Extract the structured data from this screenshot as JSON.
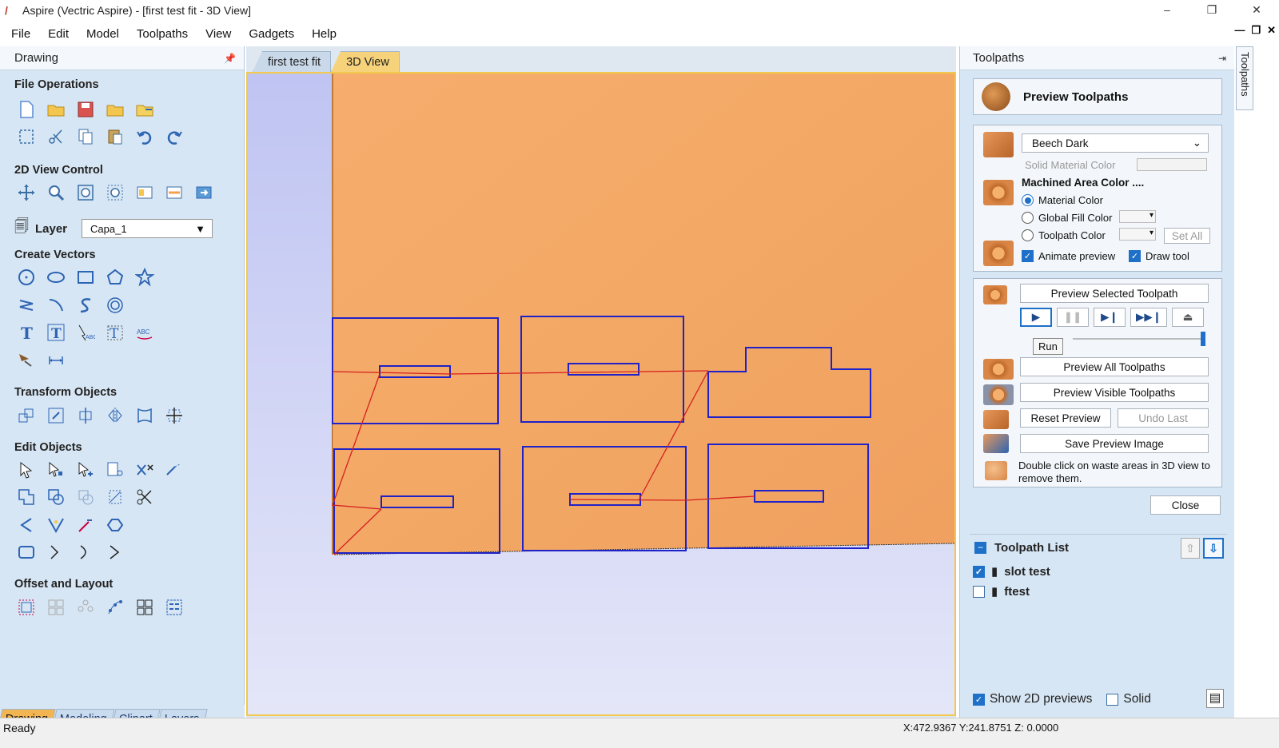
{
  "window": {
    "title": "Aspire (Vectric Aspire) - [first test fit - 3D View]",
    "minimize": "–",
    "restore": "❐",
    "close": "✕"
  },
  "menu": [
    "File",
    "Edit",
    "Model",
    "Toolpaths",
    "View",
    "Gadgets",
    "Help"
  ],
  "left_panel": {
    "title": "Drawing",
    "sections": {
      "file_operations": "File Operations",
      "view_control": "2D View Control",
      "create_vectors": "Create Vectors",
      "transform_objects": "Transform Objects",
      "edit_objects": "Edit Objects",
      "offset_layout": "Offset and Layout"
    },
    "layer_label": "Layer",
    "layer_value": "Capa_1",
    "bottom_tabs": [
      "Drawing",
      "Modeling",
      "Clipart",
      "Layers"
    ]
  },
  "doc_tabs": [
    "first test fit",
    "3D View"
  ],
  "right_panel": {
    "title": "Toolpaths",
    "preview_title": "Preview Toolpaths",
    "material": "Beech Dark",
    "solid_material_color": "Solid Material Color",
    "machined_area_color": "Machined Area Color ....",
    "material_color": "Material Color",
    "global_fill_color": "Global Fill Color",
    "toolpath_color": "Toolpath Color",
    "set_all": "Set All",
    "animate_preview": "Animate preview",
    "draw_tool": "Draw tool",
    "preview_selected": "Preview Selected Toolpath",
    "run_tooltip": "Run",
    "preview_all": "Preview All Toolpaths",
    "preview_visible": "Preview Visible Toolpaths",
    "reset_preview": "Reset Preview",
    "undo_last": "Undo Last",
    "save_preview_image": "Save Preview Image",
    "hint": "Double click on waste areas in 3D view to remove them.",
    "close": "Close",
    "toolpath_list_title": "Toolpath List",
    "toolpaths": [
      {
        "name": "slot test",
        "checked": true
      },
      {
        "name": "ftest",
        "checked": false
      }
    ],
    "show_2d_previews": "Show 2D previews",
    "solid": "Solid"
  },
  "side_tab": "Toolpaths",
  "status": {
    "left": "Ready",
    "coords": "X:472.9367 Y:241.8751 Z:  0.0000"
  },
  "colors": {
    "panel_bg": "#d7e6f4",
    "wood": "#f2a765",
    "vector_blue": "#1f22c8",
    "toolpath_red": "#d42020",
    "accent": "#1e70c8"
  }
}
